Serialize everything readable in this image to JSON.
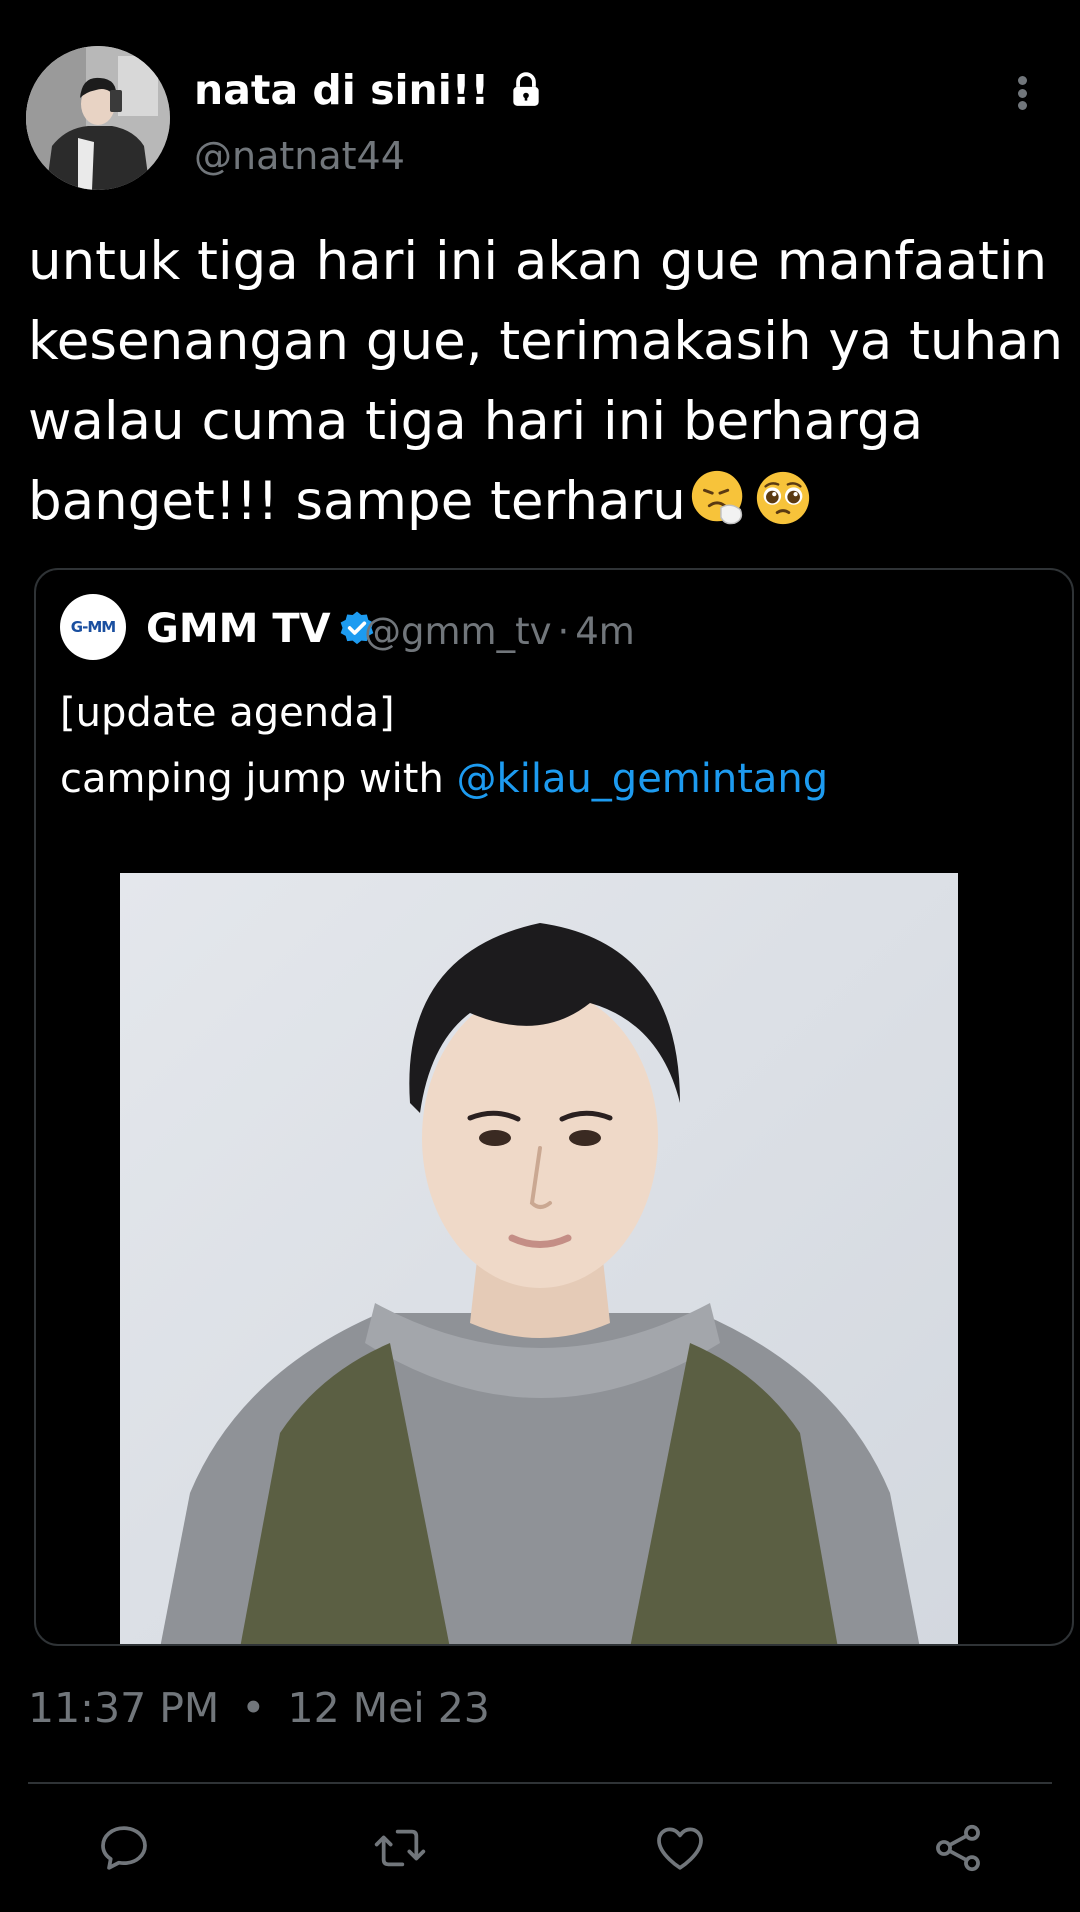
{
  "tweet": {
    "display_name": "nata di sini!!",
    "handle": "@natnat44",
    "text_lines": [
      "untuk tiga hari ini akan gue manfaatin",
      "kesenangan gue, terimakasih ya tuhan",
      "walau cuma tiga hari ini berharga",
      "banget!!! sampe terharu"
    ],
    "emojis": [
      "sneezing-face-emoji",
      "pleading-face-emoji"
    ],
    "time": "11:37 PM",
    "date": "12 Mei 23",
    "separator": "•"
  },
  "quoted": {
    "avatar_text": "G-MM",
    "display_name": "GMM TV",
    "handle": "@gmm_tv",
    "separator": "·",
    "age": "4m",
    "text_line1": "[update agenda]",
    "text_line2_prefix": "camping jump with ",
    "mention": "@kilau_gemintang"
  },
  "actions": {
    "icons": [
      "reply-icon",
      "retweet-icon",
      "like-icon",
      "share-icon"
    ]
  },
  "colors": {
    "background": "#000000",
    "text_primary": "#ffffff",
    "text_secondary": "#71767b",
    "link": "#1d9bf0",
    "border": "#2f3336",
    "verified": "#1d9bf0"
  }
}
